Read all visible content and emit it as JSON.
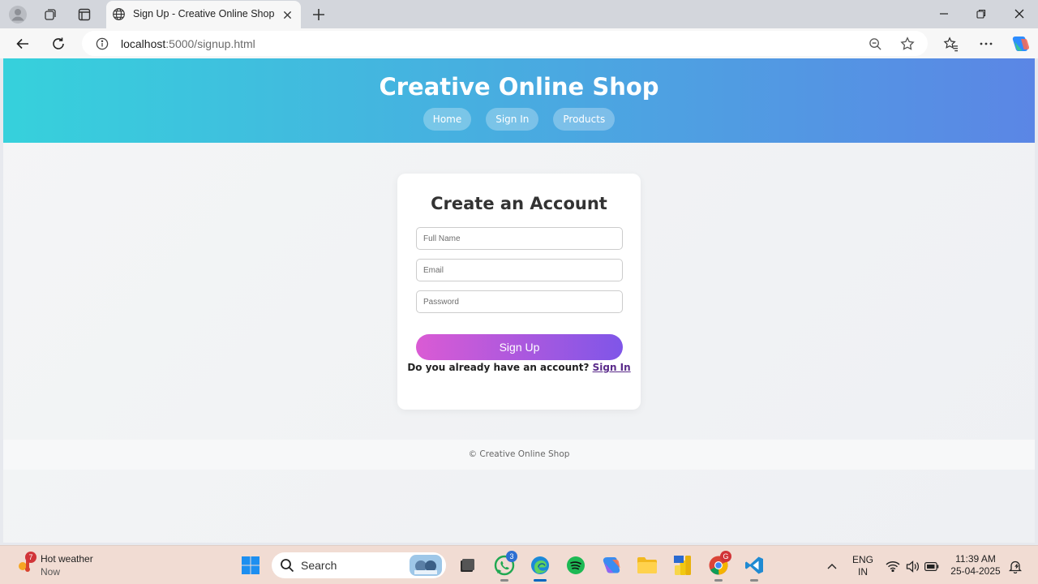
{
  "browser": {
    "tab": {
      "title": "Sign Up - Creative Online Shop"
    },
    "address": {
      "host": "localhost",
      "path": ":5000/signup.html"
    }
  },
  "site": {
    "title": "Creative Online Shop",
    "nav": [
      {
        "label": "Home"
      },
      {
        "label": "Sign In"
      },
      {
        "label": "Products"
      }
    ],
    "form": {
      "heading": "Create an Account",
      "fields": {
        "full_name": {
          "placeholder": "Full Name",
          "value": ""
        },
        "email": {
          "placeholder": "Email",
          "value": ""
        },
        "password": {
          "placeholder": "Password",
          "value": ""
        }
      },
      "submit_label": "Sign Up",
      "prompt": "Do you already have an account?",
      "signin_link": "Sign In"
    },
    "footer": "© Creative Online Shop",
    "colors": {
      "header_gradient": [
        "#36d1dc",
        "#5b86e5"
      ],
      "button_gradient": [
        "#da5bd4",
        "#7f56e8"
      ]
    }
  },
  "taskbar": {
    "weather": {
      "title": "Hot weather",
      "subtitle": "Now",
      "badge": "7"
    },
    "search_label": "Search",
    "apps": [
      {
        "name": "start",
        "icon": "windows-logo-icon"
      },
      {
        "name": "task-view",
        "icon": "task-view-icon"
      },
      {
        "name": "whatsapp",
        "icon": "whatsapp-icon",
        "badge": "3"
      },
      {
        "name": "edge",
        "icon": "edge-icon",
        "active": true
      },
      {
        "name": "spotify",
        "icon": "spotify-icon"
      },
      {
        "name": "copilot",
        "icon": "copilot-icon"
      },
      {
        "name": "file-explorer",
        "icon": "folder-icon"
      },
      {
        "name": "power-bi",
        "icon": "power-bi-icon"
      },
      {
        "name": "chrome",
        "icon": "chrome-icon",
        "badge": "G"
      },
      {
        "name": "vscode",
        "icon": "vscode-icon"
      }
    ],
    "tray": {
      "language": "ENG",
      "region": "IN",
      "time": "11:39 AM",
      "date": "25-04-2025"
    }
  }
}
